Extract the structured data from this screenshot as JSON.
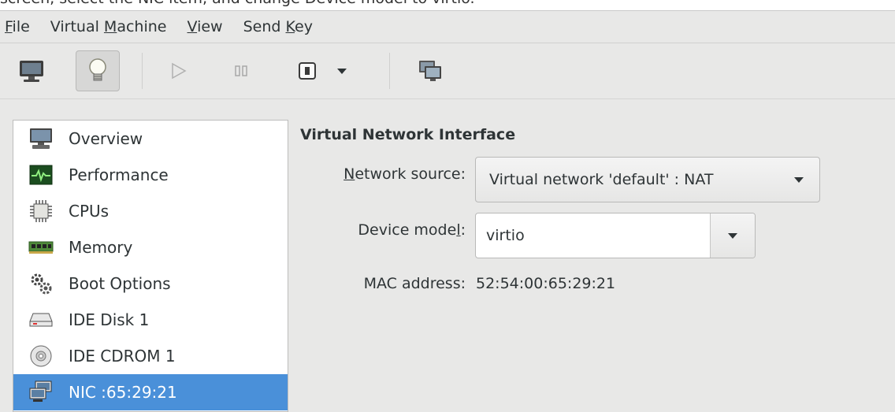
{
  "caption": "screen, select the NIC item, and change Device model to virtio.",
  "menubar": {
    "items": [
      {
        "pre": "",
        "key": "F",
        "post": "ile"
      },
      {
        "pre": "Virtual ",
        "key": "M",
        "post": "achine"
      },
      {
        "pre": "",
        "key": "V",
        "post": "iew"
      },
      {
        "pre": "Send ",
        "key": "K",
        "post": "ey"
      }
    ]
  },
  "sidebar": {
    "items": [
      {
        "label": "Overview",
        "icon": "monitor-icon"
      },
      {
        "label": "Performance",
        "icon": "performance-graph-icon"
      },
      {
        "label": "CPUs",
        "icon": "cpu-chip-icon"
      },
      {
        "label": "Memory",
        "icon": "memory-module-icon"
      },
      {
        "label": "Boot Options",
        "icon": "gears-icon"
      },
      {
        "label": "IDE Disk 1",
        "icon": "hard-disk-icon"
      },
      {
        "label": "IDE CDROM 1",
        "icon": "cdrom-icon"
      },
      {
        "label": "NIC :65:29:21",
        "icon": "network-icon",
        "selected": true
      }
    ]
  },
  "detail": {
    "title": "Virtual Network Interface",
    "network_source": {
      "label_key": "N",
      "label_rest": "etwork source:",
      "value": "Virtual network 'default' : NAT"
    },
    "device_model": {
      "label_pre": "Device mode",
      "label_key": "l",
      "label_post": ":",
      "value": "virtio"
    },
    "mac": {
      "label": "MAC address:",
      "value": "52:54:00:65:29:21"
    }
  },
  "colors": {
    "selection": "#4a90d9",
    "window_bg": "#e8e8e7"
  }
}
